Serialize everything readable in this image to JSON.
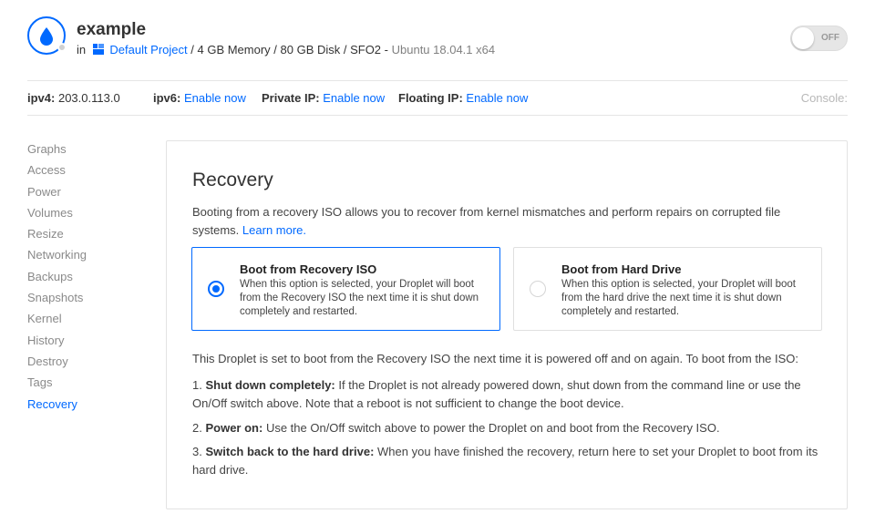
{
  "header": {
    "title": "example",
    "in_label": "in",
    "project": "Default Project",
    "specs": "/ 4 GB Memory / 80 GB Disk / SFO2 -",
    "image": "Ubuntu 18.04.1 x64",
    "power_toggle": "OFF"
  },
  "ipbar": {
    "ipv4_label": "ipv4:",
    "ipv4_value": "203.0.113.0",
    "ipv6_label": "ipv6:",
    "ipv6_action": "Enable now",
    "private_label": "Private IP:",
    "private_action": "Enable now",
    "floating_label": "Floating IP:",
    "floating_action": "Enable now",
    "console": "Console:"
  },
  "sidebar": {
    "items": [
      {
        "label": "Graphs"
      },
      {
        "label": "Access"
      },
      {
        "label": "Power"
      },
      {
        "label": "Volumes"
      },
      {
        "label": "Resize"
      },
      {
        "label": "Networking"
      },
      {
        "label": "Backups"
      },
      {
        "label": "Snapshots"
      },
      {
        "label": "Kernel"
      },
      {
        "label": "History"
      },
      {
        "label": "Destroy"
      },
      {
        "label": "Tags"
      },
      {
        "label": "Recovery"
      }
    ],
    "active": "Recovery"
  },
  "recovery": {
    "title": "Recovery",
    "intro": "Booting from a recovery ISO allows you to recover from kernel mismatches and perform repairs on corrupted file systems.",
    "learn_more": "Learn more.",
    "options": [
      {
        "title": "Boot from Recovery ISO",
        "description": "When this option is selected, your Droplet will boot from the Recovery ISO the next time it is shut down completely and restarted.",
        "selected": true
      },
      {
        "title": "Boot from Hard Drive",
        "description": "When this option is selected, your Droplet will boot from the hard drive the next time it is shut down completely and restarted.",
        "selected": false
      }
    ],
    "status": "This Droplet is set to boot from the Recovery ISO the next time it is powered off and on again. To boot from the ISO:",
    "steps": [
      {
        "prefix": "1.",
        "bold": "Shut down completely:",
        "text": "If the Droplet is not already powered down, shut down from the command line or use the On/Off switch above. Note that a reboot is not sufficient to change the boot device."
      },
      {
        "prefix": "2.",
        "bold": "Power on:",
        "text": "Use the On/Off switch above to power the Droplet on and boot from the Recovery ISO."
      },
      {
        "prefix": "3.",
        "bold": "Switch back to the hard drive:",
        "text": "When you have finished the recovery, return here to set your Droplet to boot from its hard drive."
      }
    ]
  },
  "colors": {
    "accent": "#0069ff",
    "muted": "#8a8a8a"
  },
  "icons": {
    "droplet": "droplet-icon",
    "project": "project-grid-icon",
    "radio": "radio-icon"
  }
}
